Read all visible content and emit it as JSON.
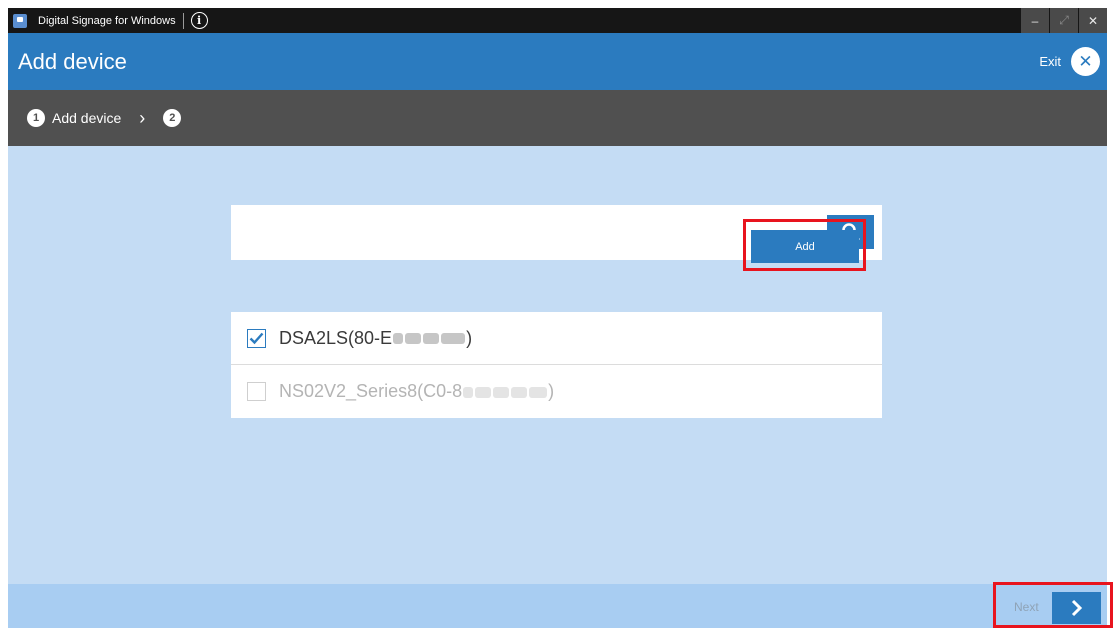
{
  "titlebar": {
    "app_title": "Digital Signage for Windows",
    "info_glyph": "i",
    "minimize_glyph": "–",
    "maximize_glyph": "⤢",
    "close_glyph": "✕"
  },
  "header": {
    "title": "Add device",
    "exit_label": "Exit",
    "exit_icon_glyph": "✕"
  },
  "steps": [
    {
      "number": "1",
      "label": "Add device"
    },
    {
      "number": "2",
      "label": ""
    }
  ],
  "steps_separator": "›",
  "search": {
    "value": "",
    "icon": "search-icon"
  },
  "devices": [
    {
      "prefix": "DSA2LS(80-E",
      "suffix": ")",
      "checked": true
    },
    {
      "prefix": "NS02V2_Series8(C0-8",
      "suffix": ")",
      "checked": false
    }
  ],
  "add_button": {
    "label": "Add"
  },
  "footer": {
    "next_label": "Next",
    "next_icon": "chevron-right-icon"
  },
  "colors": {
    "primary": "#2b7bbf",
    "main_bg": "#c4dcf4",
    "footer_bg": "#a8cdf2",
    "steps_bg": "#505050",
    "highlight": "#e8141e"
  }
}
